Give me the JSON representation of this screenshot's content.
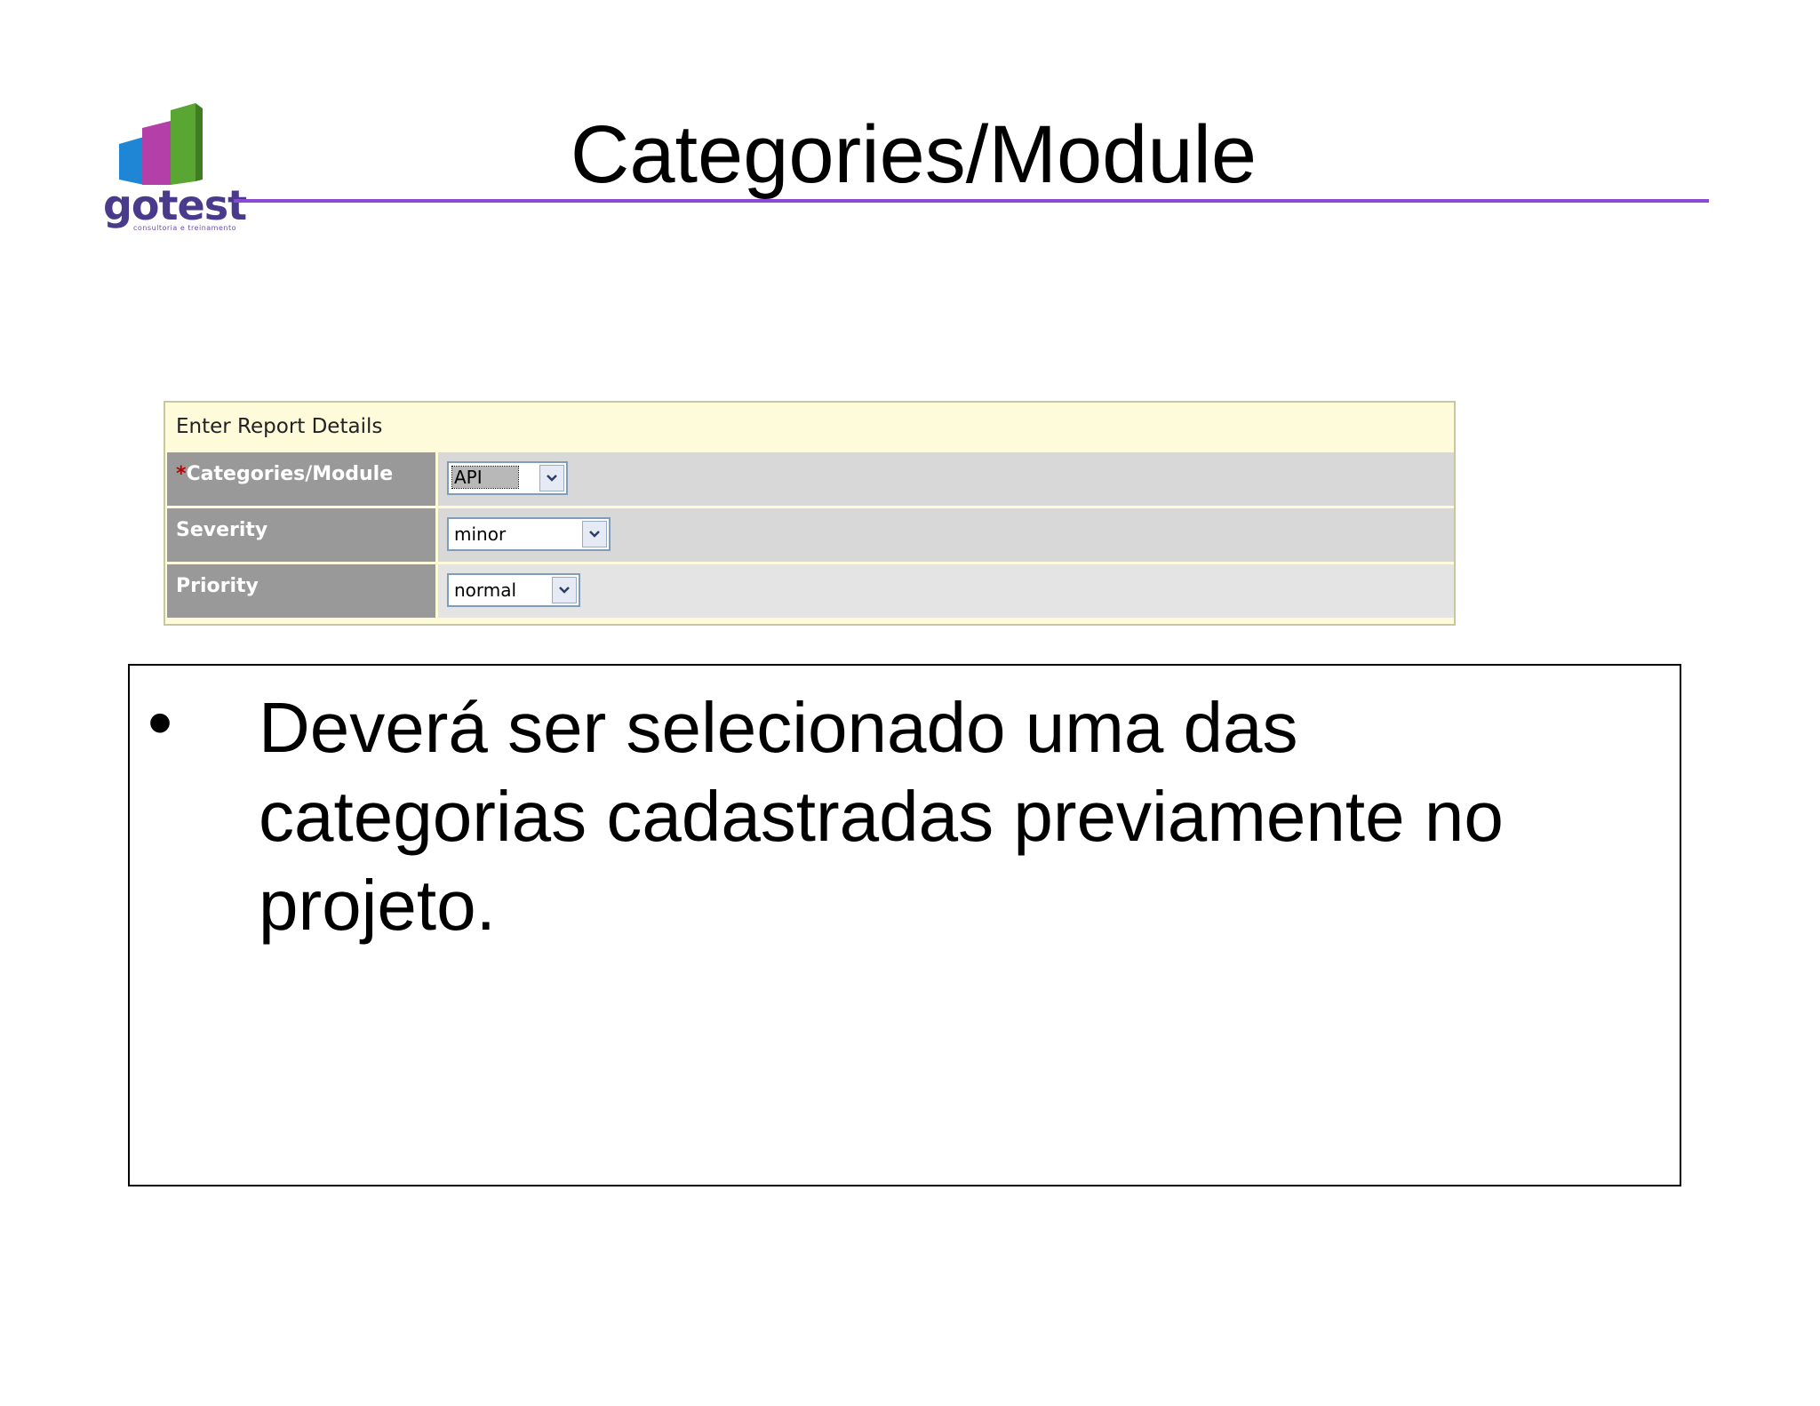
{
  "logo": {
    "word": "gotest",
    "tagline": "consultoria e treinamento"
  },
  "slide": {
    "title": "Categories/Module"
  },
  "form": {
    "heading": "Enter Report Details",
    "rows": [
      {
        "required_mark": "*",
        "label": "Categories/Module",
        "value": "API"
      },
      {
        "required_mark": "",
        "label": "Severity",
        "value": "minor"
      },
      {
        "required_mark": "",
        "label": "Priority",
        "value": "normal"
      }
    ]
  },
  "body": {
    "bullet": "•",
    "text": "Deverá ser selecionado uma das categorias cadastradas previamente no projeto."
  },
  "colors": {
    "rule": "#8a4ad6",
    "label_bg": "#999999",
    "form_bg": "#fdfbd9",
    "required": "#c00000"
  }
}
